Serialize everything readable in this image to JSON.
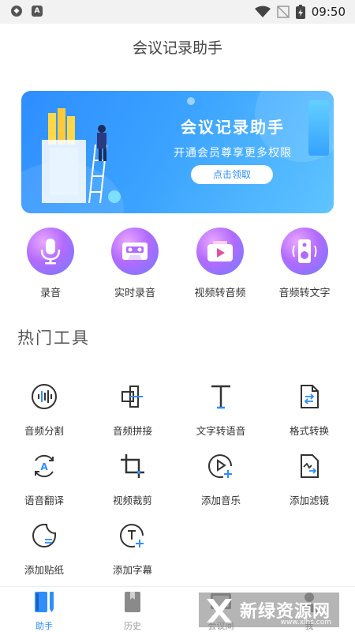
{
  "status_bar": {
    "time": "09:50"
  },
  "app_title": "会议记录助手",
  "banner": {
    "title": "会议记录助手",
    "subtitle": "开通会员尊享更多权限",
    "button": "点击领取"
  },
  "quick_actions": [
    {
      "label": "录音",
      "icon": "microphone-icon"
    },
    {
      "label": "实时录音",
      "icon": "cassette-icon"
    },
    {
      "label": "视频转音频",
      "icon": "video-play-icon"
    },
    {
      "label": "音频转文字",
      "icon": "speaker-icon"
    }
  ],
  "section_title": "热门工具",
  "tools": [
    {
      "label": "音频分割",
      "icon": "audio-wave-icon"
    },
    {
      "label": "音频拼接",
      "icon": "audio-merge-icon"
    },
    {
      "label": "文字转语音",
      "icon": "text-t-icon"
    },
    {
      "label": "格式转换",
      "icon": "file-convert-icon"
    },
    {
      "label": "语音翻译",
      "icon": "translate-icon"
    },
    {
      "label": "视频裁剪",
      "icon": "crop-icon"
    },
    {
      "label": "添加音乐",
      "icon": "add-music-icon"
    },
    {
      "label": "添加滤镜",
      "icon": "add-filter-icon"
    },
    {
      "label": "添加贴纸",
      "icon": "sticker-icon"
    },
    {
      "label": "添加字幕",
      "icon": "add-subtitle-icon"
    }
  ],
  "tabbar": [
    {
      "label": "助手",
      "active": true
    },
    {
      "label": "历史",
      "active": false
    },
    {
      "label": "会议间",
      "active": false
    },
    {
      "label": "我",
      "active": false
    }
  ],
  "watermark": {
    "text": "新绿资源网",
    "url": "www.xlhs.com"
  },
  "colors": {
    "accent": "#2f8dff",
    "quick_gradient_start": "#e9a6ff",
    "quick_gradient_end": "#6f7bff"
  }
}
